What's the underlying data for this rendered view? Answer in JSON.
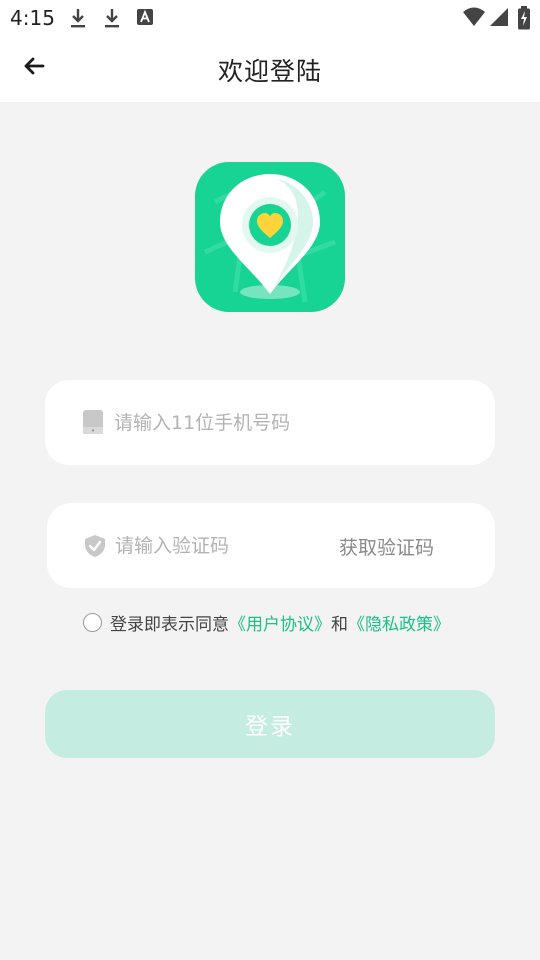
{
  "status_bar": {
    "time": "4:15",
    "notifications": [
      "download-icon",
      "download-icon",
      "text-a-icon"
    ],
    "indicators": [
      "wifi-icon",
      "signal-icon",
      "battery-charging-icon"
    ]
  },
  "header": {
    "back_icon": "arrow-left-icon",
    "title": "欢迎登陆"
  },
  "logo": {
    "icon": "location-pin-heart-icon"
  },
  "phone_field": {
    "icon": "phone-icon",
    "placeholder": "请输入11位手机号码",
    "value": ""
  },
  "code_field": {
    "icon": "shield-check-icon",
    "placeholder": "请输入验证码",
    "value": "",
    "get_code_label": "获取验证码"
  },
  "agreement": {
    "checked": false,
    "prefix": "登录即表示同意",
    "user_agreement": "《用户协议》",
    "conjunction": "和",
    "privacy_policy": "《隐私政策》"
  },
  "login_button": {
    "label": "登录"
  },
  "colors": {
    "brand": "#17d394",
    "link": "#1bbf8a",
    "login_button_disabled": "#c5ece0",
    "page_background": "#f3f3f3",
    "heart": "#ffd43b"
  }
}
